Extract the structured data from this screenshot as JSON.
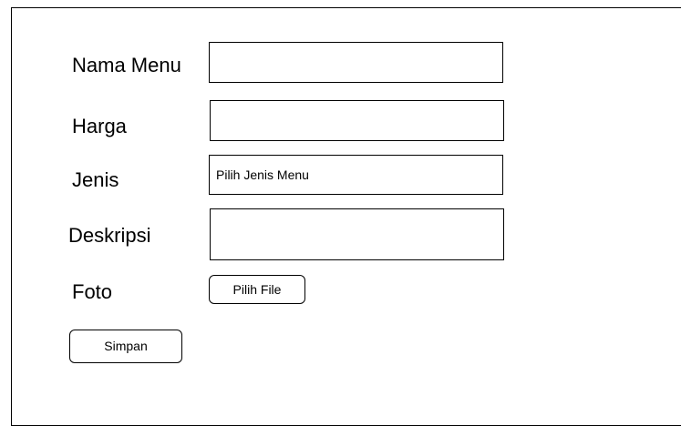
{
  "form": {
    "fields": {
      "nama_menu": {
        "label": "Nama Menu",
        "value": ""
      },
      "harga": {
        "label": "Harga",
        "value": ""
      },
      "jenis": {
        "label": "Jenis",
        "selected": "Pilih Jenis Menu"
      },
      "deskripsi": {
        "label": "Deskripsi",
        "value": ""
      },
      "foto": {
        "label": "Foto",
        "button": "Pilih File"
      }
    },
    "submit_label": "Simpan"
  }
}
